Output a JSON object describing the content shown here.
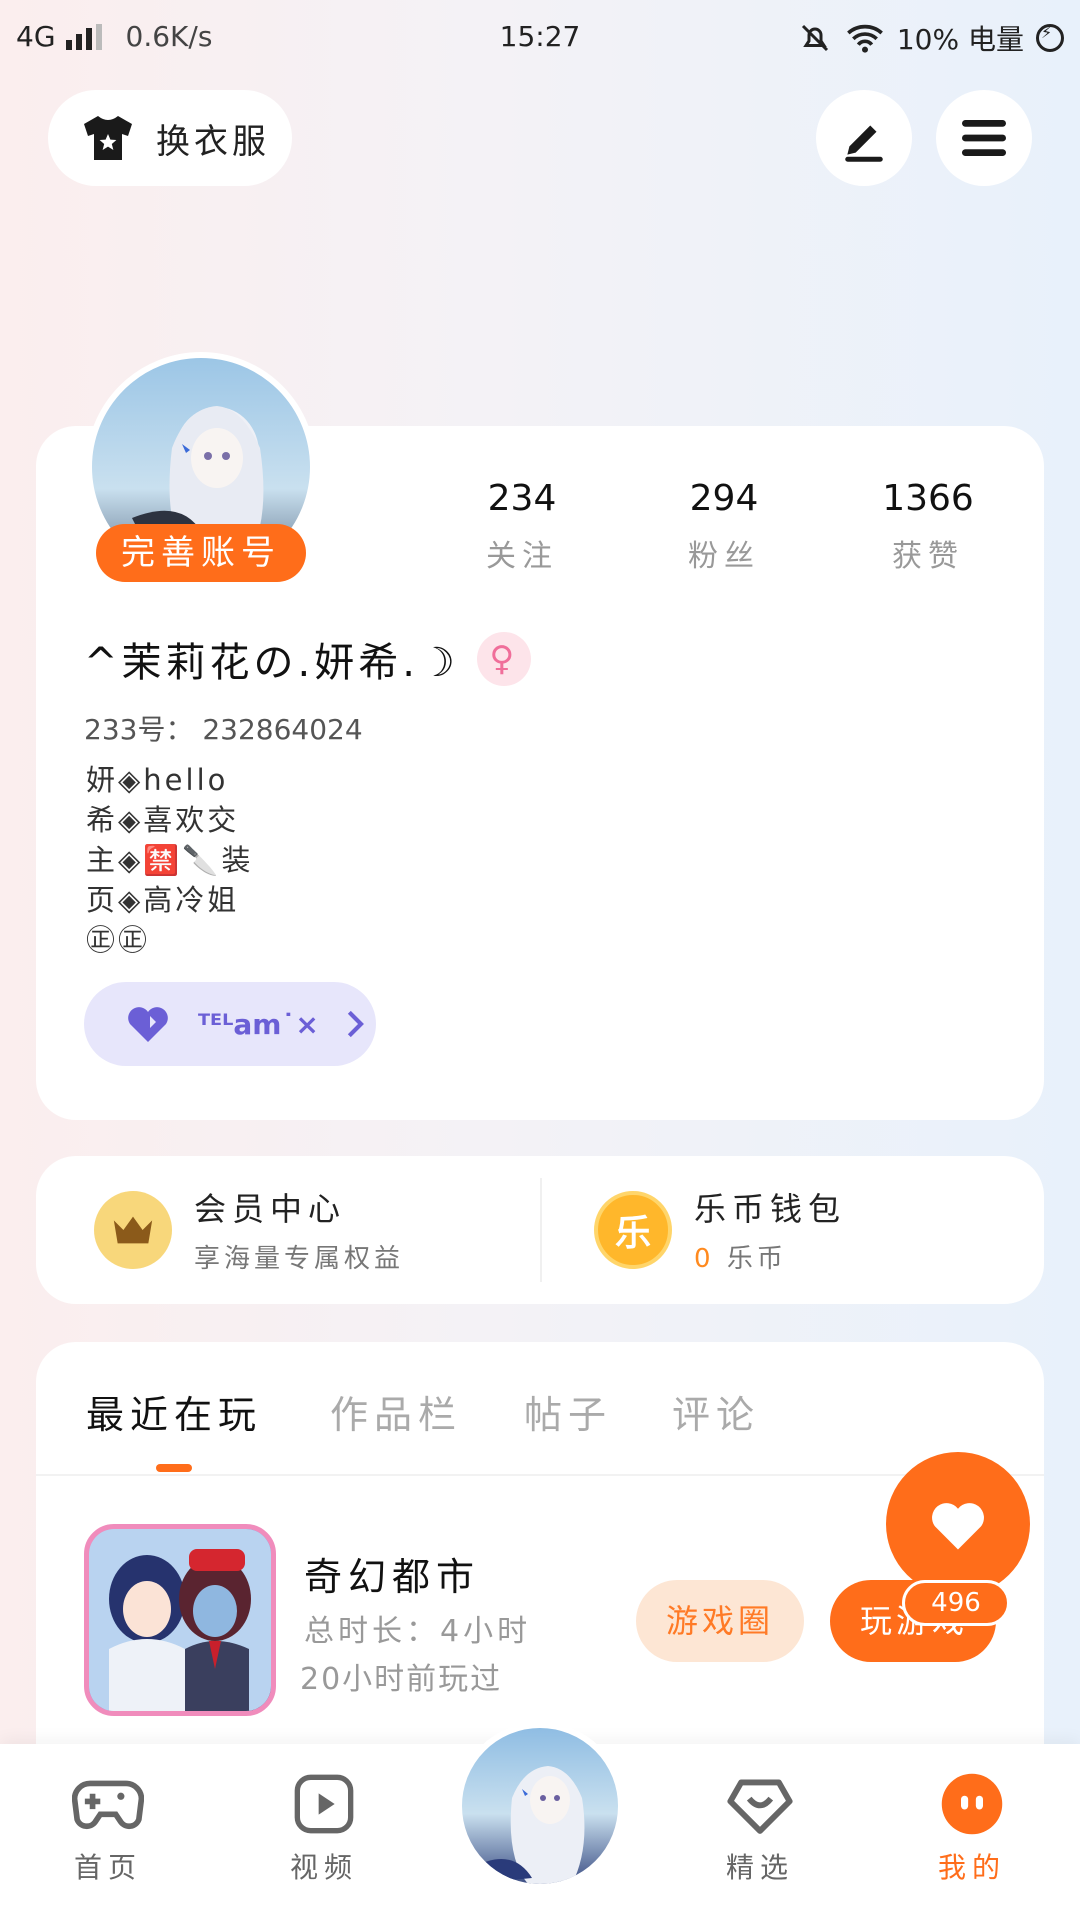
{
  "status_bar": {
    "network": "4G",
    "speed": "0.6K/s",
    "time": "15:27",
    "battery_text": "10% 电量"
  },
  "top_bar": {
    "outfit_label": "换衣服"
  },
  "profile": {
    "complete_label": "完善账号",
    "stats": [
      {
        "value": "234",
        "label": "关注"
      },
      {
        "value": "294",
        "label": "粉丝"
      },
      {
        "value": "1366",
        "label": "获赞"
      }
    ],
    "username": "^茉莉花の.妍希.☽",
    "gender_symbol": "♀",
    "id_text": "233号： 232864024",
    "bio_lines": [
      "妍◈hello",
      "希◈喜欢交",
      "主◈🈲🔪装",
      "页◈高冷姐",
      "㊣㊣"
    ],
    "tag_text": "ᵀᴱᴸam˙×"
  },
  "member": {
    "title": "会员中心",
    "subtitle": "享海量专属权益"
  },
  "wallet": {
    "icon_char": "乐",
    "title": "乐币钱包",
    "amount": "0",
    "unit": "乐币"
  },
  "tabs": [
    "最近在玩",
    "作品栏",
    "帖子",
    "评论"
  ],
  "game": {
    "title": "奇幻都市",
    "total_time": "总时长：4小时",
    "last_played": "20小时前玩过",
    "circle_label": "游戏圈",
    "play_label": "玩游戏"
  },
  "like_count": "496",
  "bottom_nav": [
    {
      "label": "首页"
    },
    {
      "label": "视频"
    },
    {
      "label": "精选"
    },
    {
      "label": "我的"
    }
  ],
  "colors": {
    "accent": "#ff6d1a",
    "accent_light": "#fde6d4",
    "tag_bg": "#e7e6fb",
    "tag_fg": "#6b5fd6"
  }
}
